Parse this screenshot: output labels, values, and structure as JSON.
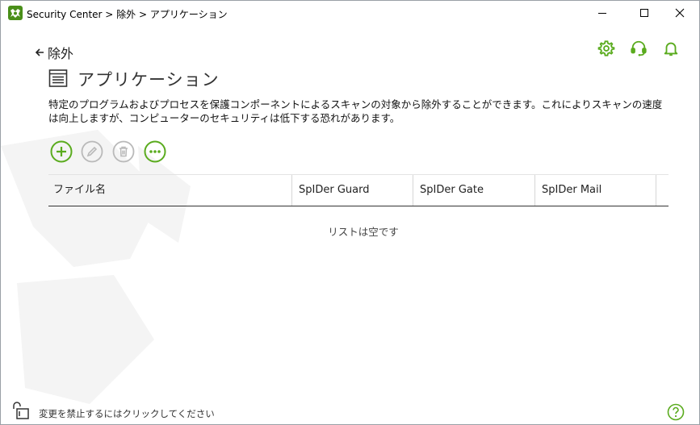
{
  "window": {
    "title": "Security Center > 除外 > アプリケーション",
    "minimize_icon": "minimize-icon",
    "maximize_icon": "maximize-icon",
    "close_icon": "close-icon"
  },
  "header": {
    "icons": [
      "gear-icon",
      "headset-icon",
      "bell-icon"
    ]
  },
  "nav": {
    "back_label": "除外"
  },
  "page": {
    "title": "アプリケーション",
    "description": "特定のプログラムおよびプロセスを保護コンポーネントによるスキャンの対象から除外することができます。これによりスキャンの速度は向上しますが、コンピューターのセキュリティは低下する恐れがあります。"
  },
  "toolbar": {
    "buttons": [
      "plus-icon",
      "pencil-icon",
      "trash-icon",
      "more-icon"
    ]
  },
  "table": {
    "columns": [
      "ファイル名",
      "SpIDer Guard",
      "SpIDer Gate",
      "SpIDer Mail"
    ],
    "rows": [],
    "empty_message": "リストは空です"
  },
  "footer": {
    "lock_text": "変更を禁止するにはクリックしてください",
    "help_icon": "help-icon"
  },
  "colors": {
    "accent": "#5aab1e",
    "disabled": "#b9b9b9",
    "text": "#1a1a1a"
  }
}
